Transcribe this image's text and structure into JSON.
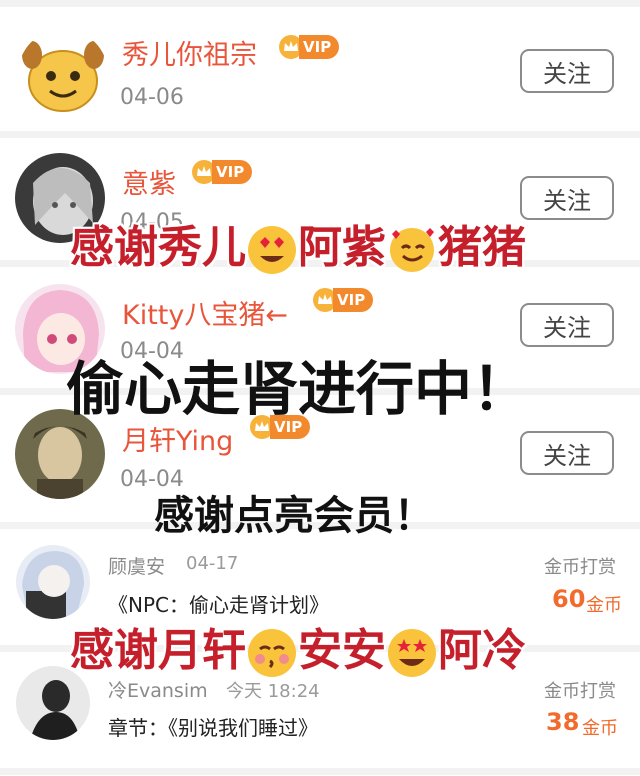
{
  "follows": [
    {
      "name": "秀儿你祖宗",
      "vip": "VIP",
      "date": "04-06",
      "button": "关注",
      "avatar_icon": "doge-face-icon"
    },
    {
      "name": "意紫",
      "vip": "VIP",
      "date": "04-05",
      "button": "关注",
      "avatar_icon": "anime-girl-gray-avatar"
    },
    {
      "name": "Kitty八宝猪←",
      "vip": "VIP",
      "date": "04-04",
      "button": "关注",
      "avatar_icon": "anime-girl-pink-avatar"
    },
    {
      "name": "月轩Ying",
      "vip": "VIP",
      "date": "04-04",
      "button": "关注",
      "avatar_icon": "portrait-painting-avatar"
    }
  ],
  "gifts": [
    {
      "name": "顾虞安",
      "date": "04-17",
      "label": "金币打赏",
      "title": "《NPC：偷心走肾计划》",
      "amount": "60",
      "unit": "金币",
      "avatar_icon": "anime-boy-avatar"
    },
    {
      "name": "冷Evansim",
      "date": "今天 18:24",
      "label": "金币打赏",
      "title": "章节：《别说我们睡过》",
      "amount": "38",
      "unit": "金币",
      "avatar_icon": "bw-person-avatar"
    }
  ],
  "overlays": {
    "line1": {
      "a": "感谢秀儿",
      "b": "阿紫",
      "c": "猪猪"
    },
    "line2": "偷心走肾进行中！",
    "line3": "感谢点亮会员！",
    "line4": {
      "a": "感谢月轩",
      "b": "安安",
      "c": "阿冷"
    }
  },
  "colors": {
    "accent": "#e8553a",
    "overlay_red": "#c61f2c",
    "vip": "#f28a2d"
  }
}
